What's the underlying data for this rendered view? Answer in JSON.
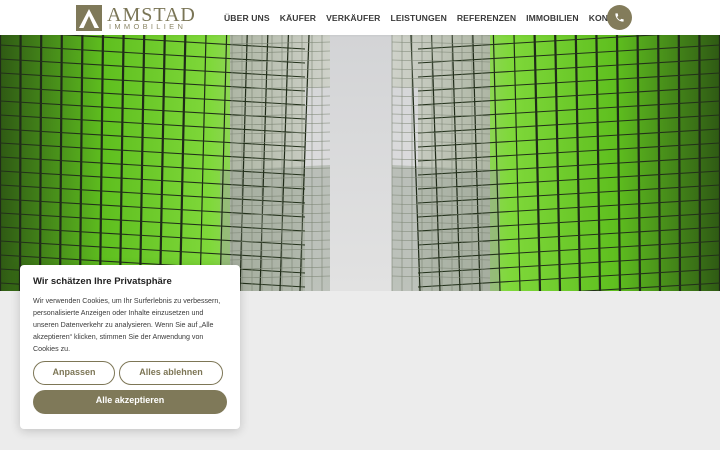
{
  "brand": {
    "name": "AMSTAD",
    "subtitle": "IMMOBILIEN",
    "color": "#7f7959"
  },
  "nav": {
    "items": [
      "ÜBER UNS",
      "KÄUFER",
      "VERKÄUFER",
      "LEISTUNGEN",
      "REFERENZEN",
      "IMMOBILIEN",
      "KONTAKT"
    ],
    "phone_icon": "phone-icon"
  },
  "hero": {
    "image": "low-angle-glass-skyscrapers-green-reflection"
  },
  "cookie": {
    "title": "Wir schätzen Ihre Privatsphäre",
    "text": "Wir verwenden Cookies, um Ihr Surferlebnis zu verbessern, personalisierte Anzeigen oder Inhalte einzusetzen und unseren Datenverkehr zu analysieren. Wenn Sie auf „Alle akzeptieren“ klicken, stimmen Sie der Anwendung von Cookies zu.",
    "customize_label": "Anpassen",
    "reject_label": "Alles ablehnen",
    "accept_label": "Alle akzeptieren"
  }
}
